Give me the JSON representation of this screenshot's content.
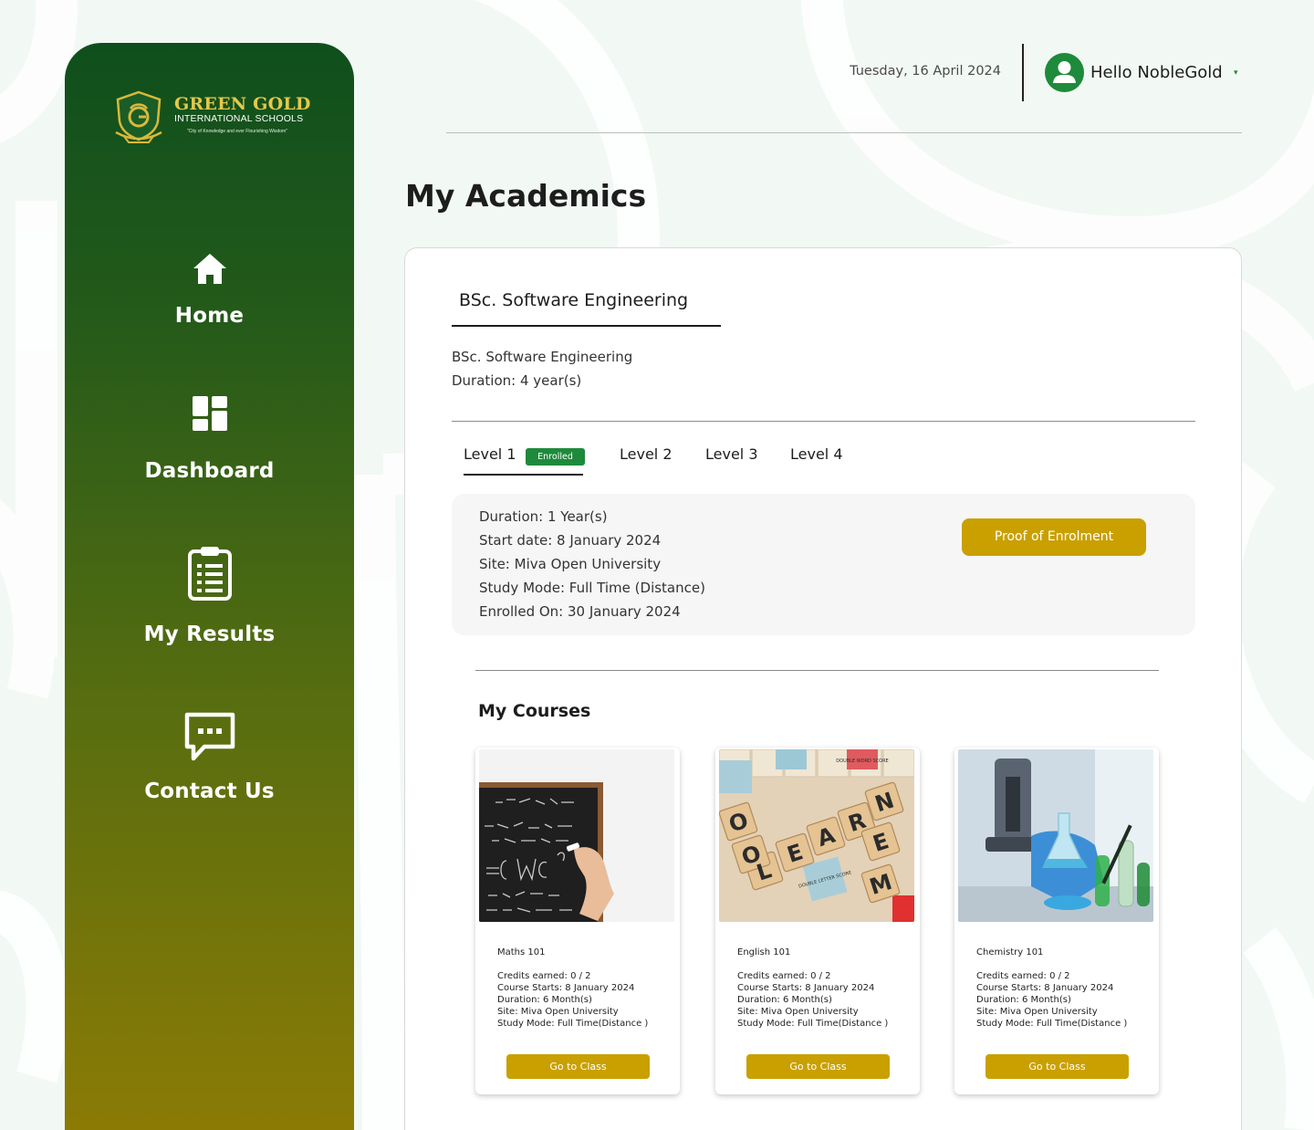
{
  "brand": {
    "name": "GREEN GOLD",
    "subtitle": "INTERNATIONAL SCHOOLS",
    "tagline": "\"City of Knowledge and ever Flourishing Wisdom\"",
    "primary_color": "#1e8a3b",
    "accent_color": "#c9a000"
  },
  "sidebar": {
    "items": [
      {
        "label": "Home",
        "icon": "home-icon"
      },
      {
        "label": "Dashboard",
        "icon": "dashboard-icon"
      },
      {
        "label": "My Results",
        "icon": "clipboard-icon"
      },
      {
        "label": "Contact Us",
        "icon": "chat-icon"
      }
    ]
  },
  "header": {
    "date": "Tuesday, 16 April 2024",
    "greeting": "Hello NobleGold",
    "caret": "▾"
  },
  "page": {
    "title": "My Academics"
  },
  "program": {
    "tab_label": "BSc. Software Engineering",
    "name": "BSc. Software Engineering",
    "duration": "Duration: 4 year(s)"
  },
  "levels": {
    "tabs": [
      "Level 1",
      "Level 2",
      "Level 3",
      "Level 4"
    ],
    "enrolled_badge": "Enrolled",
    "active": "Level 1"
  },
  "level_info": {
    "duration": "Duration: 1 Year(s)",
    "start_date": "Start date: 8 January 2024",
    "site": "Site: Miva Open University",
    "study_mode": "Study Mode: Full Time (Distance)",
    "enrolled_on": "Enrolled On: 30 January 2024",
    "proof_button": "Proof of Enrolment"
  },
  "courses": {
    "title": "My Courses",
    "items": [
      {
        "name": "Maths 101",
        "credits": "Credits earned: 0 / 2",
        "starts": "Course Starts: 8 January 2024",
        "duration": "Duration: 6 Month(s)",
        "site": "Site: Miva Open University",
        "mode": "Study Mode: Full Time(Distance )",
        "button": "Go to Class"
      },
      {
        "name": "English 101",
        "credits": "Credits earned: 0 / 2",
        "starts": "Course Starts: 8 January 2024",
        "duration": "Duration: 6 Month(s)",
        "site": "Site: Miva Open University",
        "mode": "Study Mode: Full Time(Distance )",
        "button": "Go to Class"
      },
      {
        "name": "Chemistry 101",
        "credits": "Credits earned: 0 / 2",
        "starts": "Course Starts: 8 January 2024",
        "duration": "Duration: 6 Month(s)",
        "site": "Site: Miva Open University",
        "mode": "Study Mode: Full Time(Distance )",
        "button": "Go to Class"
      }
    ]
  },
  "images": {
    "scrabble_letters": [
      "L",
      "E",
      "A",
      "R",
      "N",
      "O",
      "O",
      "E",
      "M"
    ],
    "scrabble_labels": [
      "DOUBLE LETTER SCORE",
      "DOUBLE WORD SCORE"
    ]
  }
}
